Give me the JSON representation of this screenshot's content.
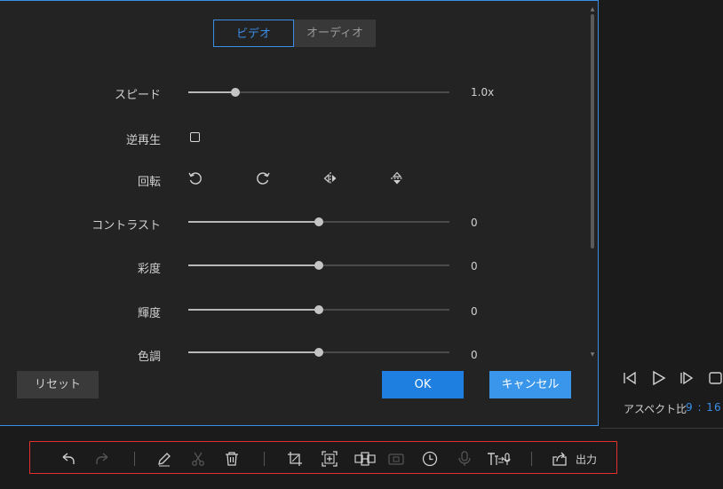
{
  "tabs": [
    {
      "label": "ビデオ",
      "active": true
    },
    {
      "label": "オーディオ",
      "active": false
    }
  ],
  "controls": {
    "speed": {
      "label": "スピード",
      "value": "1.0x",
      "level": 0.18
    },
    "reverse": {
      "label": "逆再生",
      "checked": false
    },
    "rotate": {
      "label": "回転",
      "icons": [
        "rotate-ccw-icon",
        "rotate-cw-icon",
        "flip-horizontal-icon",
        "flip-vertical-icon"
      ]
    },
    "contrast": {
      "label": "コントラスト",
      "value": "0",
      "level": 0.5
    },
    "saturation": {
      "label": "彩度",
      "value": "0",
      "level": 0.5
    },
    "brightness": {
      "label": "輝度",
      "value": "0",
      "level": 0.5
    },
    "hue": {
      "label": "色調",
      "value": "0",
      "level": 0.5
    }
  },
  "buttons": {
    "reset": "リセット",
    "ok": "OK",
    "cancel": "キャンセル"
  },
  "player": {
    "aspect_label": "アスペクト比",
    "aspect_value": "9 : 16"
  },
  "toolbar": {
    "icons": [
      "undo-icon",
      "redo-icon",
      "pencil-icon",
      "scissors-icon",
      "trash-icon",
      "crop-icon",
      "zoom-frame-icon",
      "mosaic-icon",
      "freeze-frame-icon",
      "duration-clock-icon",
      "microphone-icon",
      "text-to-speech-icon",
      "export-icon"
    ],
    "export_label": "出力"
  },
  "colors": {
    "accent": "#3a8ee6",
    "ok_button": "#1e7fe0",
    "cancel_button": "#3a96ea",
    "toolbar_border": "#e03030"
  }
}
